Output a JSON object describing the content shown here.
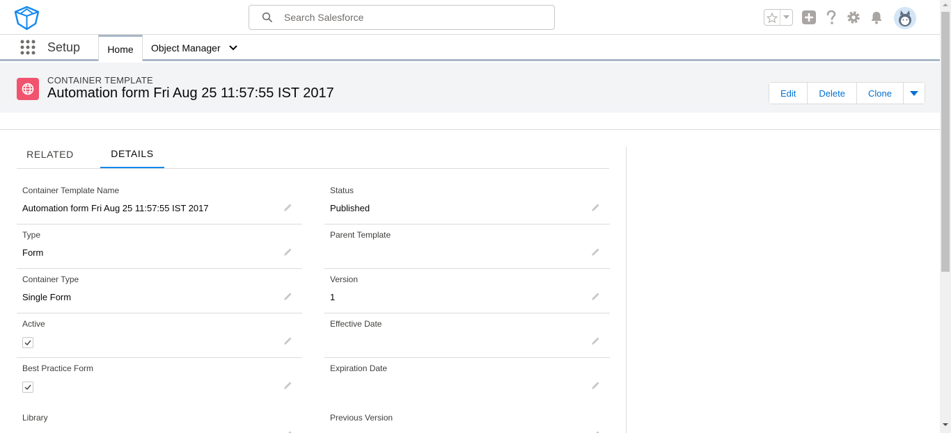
{
  "header": {
    "logo_icon": "platform-cube-icon",
    "search_placeholder": "Search Salesforce",
    "search_icon": "search-icon",
    "icons": [
      "favorites-star-icon",
      "global-actions-plus-icon",
      "help-icon",
      "setup-gear-icon",
      "notifications-bell-icon",
      "user-avatar"
    ]
  },
  "context_bar": {
    "app_name": "Setup",
    "tabs": [
      {
        "label": "Home"
      },
      {
        "label": "Object Manager"
      }
    ]
  },
  "page_header": {
    "record_type": "CONTAINER TEMPLATE",
    "title": "Automation form Fri Aug 25 11:57:55 IST 2017",
    "record_icon": "globe-icon",
    "record_icon_color": "#f1536e",
    "actions": {
      "edit": "Edit",
      "delete": "Delete",
      "clone": "Clone"
    }
  },
  "tabs": {
    "related": "RELATED",
    "details": "DETAILS",
    "active": "DETAILS"
  },
  "fields": {
    "left": [
      {
        "label": "Container Template Name",
        "value": "Automation form Fri Aug 25 11:57:55 IST 2017"
      },
      {
        "label": "Type",
        "value": "Form"
      },
      {
        "label": "Container Type",
        "value": "Single Form"
      },
      {
        "label": "Active",
        "checked": true
      },
      {
        "label": "Best Practice Form",
        "checked": true
      },
      {
        "label": "Library",
        "value": ""
      }
    ],
    "right": [
      {
        "label": "Status",
        "value": "Published"
      },
      {
        "label": "Parent Template",
        "value": ""
      },
      {
        "label": "Version",
        "value": "1"
      },
      {
        "label": "Effective Date",
        "value": ""
      },
      {
        "label": "Expiration Date",
        "value": ""
      },
      {
        "label": "Previous Version",
        "value": ""
      }
    ]
  },
  "colors": {
    "accent": "#0070d2",
    "tab_active": "#1589ee",
    "page_header_bg": "#f3f4f6"
  }
}
